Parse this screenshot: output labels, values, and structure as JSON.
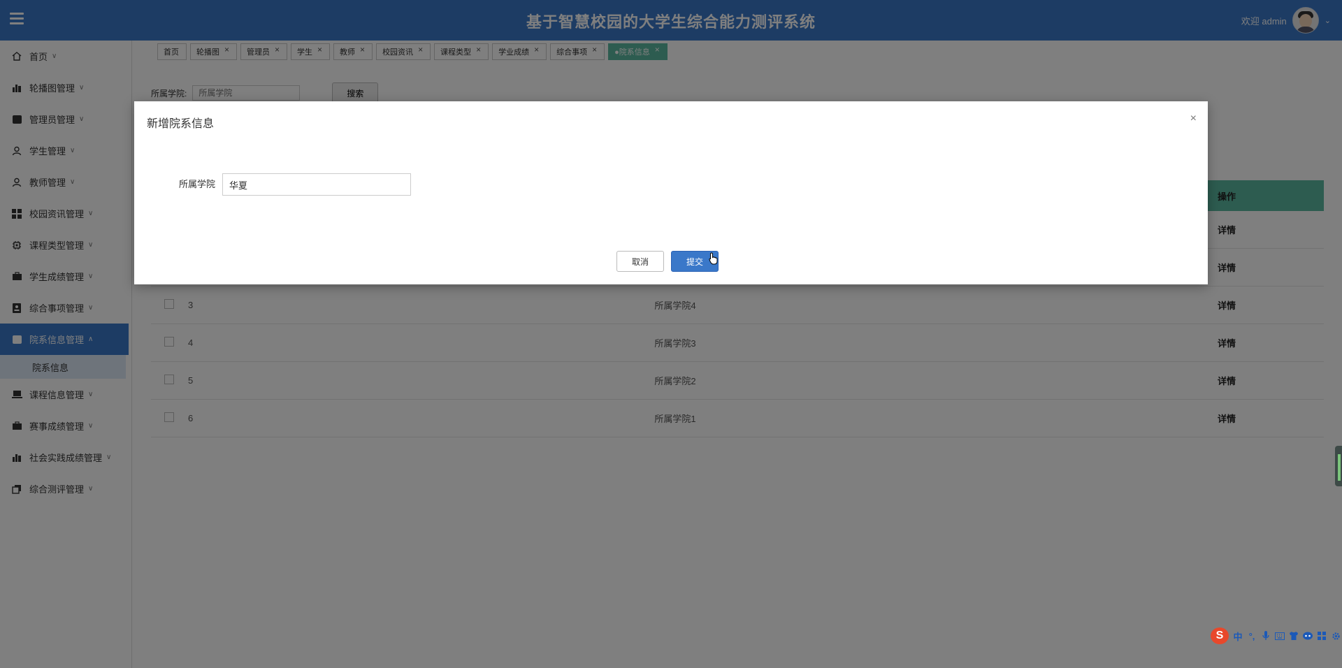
{
  "header": {
    "title": "基于智慧校园的大学生综合能力测评系统",
    "welcome": "欢迎 admin"
  },
  "sidebar": {
    "items": [
      {
        "label": "首页",
        "icon": "home-icon"
      },
      {
        "label": "轮播图管理",
        "icon": "chart-icon"
      },
      {
        "label": "管理员管理",
        "icon": "folder-icon"
      },
      {
        "label": "学生管理",
        "icon": "person-icon"
      },
      {
        "label": "教师管理",
        "icon": "person-icon"
      },
      {
        "label": "校园资讯管理",
        "icon": "grid-icon"
      },
      {
        "label": "课程类型管理",
        "icon": "chip-icon"
      },
      {
        "label": "学生成绩管理",
        "icon": "briefcase-icon"
      },
      {
        "label": "综合事项管理",
        "icon": "badge-icon"
      },
      {
        "label": "院系信息管理",
        "icon": "folder-icon"
      },
      {
        "label": "课程信息管理",
        "icon": "laptop-icon"
      },
      {
        "label": "赛事成绩管理",
        "icon": "briefcase-icon"
      },
      {
        "label": "社会实践成绩管理",
        "icon": "chart-icon"
      },
      {
        "label": "综合测评管理",
        "icon": "copy-icon"
      }
    ],
    "active_index": 9,
    "sub_item": "院系信息"
  },
  "tabs": [
    {
      "label": "首页",
      "closable": false
    },
    {
      "label": "轮播图",
      "closable": true
    },
    {
      "label": "管理员",
      "closable": true
    },
    {
      "label": "学生",
      "closable": true
    },
    {
      "label": "教师",
      "closable": true
    },
    {
      "label": "校园资讯",
      "closable": true
    },
    {
      "label": "课程类型",
      "closable": true
    },
    {
      "label": "学业成绩",
      "closable": true
    },
    {
      "label": "综合事项",
      "closable": true
    },
    {
      "label": "●院系信息",
      "closable": true,
      "active": true
    }
  ],
  "search": {
    "label": "所属学院:",
    "placeholder": "所属学院",
    "button": "搜索"
  },
  "table": {
    "op_header": "操作",
    "rows": [
      {
        "index": "3",
        "name": "所属学院4",
        "action": "详情"
      },
      {
        "index": "4",
        "name": "所属学院3",
        "action": "详情"
      },
      {
        "index": "5",
        "name": "所属学院2",
        "action": "详情"
      },
      {
        "index": "6",
        "name": "所属学院1",
        "action": "详情"
      }
    ],
    "hidden_actions": [
      "详情",
      "详情"
    ]
  },
  "modal": {
    "title": "新增院系信息",
    "close": "×",
    "field_label": "所属学院",
    "field_value": "华夏",
    "cancel": "取消",
    "submit": "提交"
  },
  "ime": {
    "lang": "中",
    "punct": "°,"
  },
  "colors": {
    "brand": "#3a78c9",
    "accent": "#5bb9a0"
  }
}
